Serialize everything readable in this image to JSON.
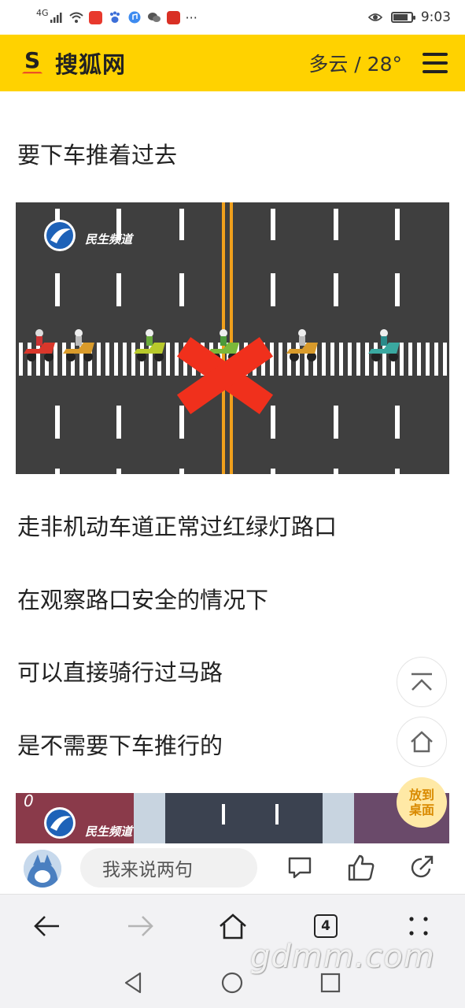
{
  "status_bar": {
    "signal": "4G",
    "time": "9:03",
    "more": "···",
    "battery_level": 0.8
  },
  "header": {
    "logo_letter": "S",
    "logo_text": "搜狐网",
    "weather": "多云 / 28°",
    "menu_icon": "hamburger-icon"
  },
  "article": {
    "paragraphs": [
      "要下车推着过去",
      "走非机动车道正常过红绿灯路口",
      "在观察路口安全的情况下",
      "可以直接骑行过马路",
      "是不需要下车推行的"
    ],
    "image1_watermark": "民生频道",
    "image2_watermark": "民生频道",
    "image2_corner_digit": "0"
  },
  "floating": {
    "to_top_icon": "arrow-up-bar-icon",
    "home_icon": "home-icon",
    "desktop_label_line1": "放到",
    "desktop_label_line2": "桌面"
  },
  "comment_bar": {
    "placeholder": "我来说两句",
    "comment_icon": "comment-icon",
    "like_icon": "thumbs-up-icon",
    "share_icon": "share-icon"
  },
  "browser_bar": {
    "back_icon": "arrow-left-icon",
    "forward_icon": "arrow-right-icon",
    "home_icon": "home-icon",
    "tab_count": "4",
    "more_icon": "grid-dots-icon"
  },
  "system_nav": {
    "back_icon": "triangle-back-icon",
    "home_icon": "circle-home-icon",
    "recent_icon": "square-recent-icon"
  },
  "watermark": "gdmm.com",
  "colors": {
    "brand_yellow": "#ffd200",
    "road": "#3f3f3f",
    "lane_orange": "#f0a01c",
    "cross_red": "#f0301c",
    "fab_yellow_bg": "#ffe9a6",
    "fab_yellow_text": "#d98a00"
  }
}
